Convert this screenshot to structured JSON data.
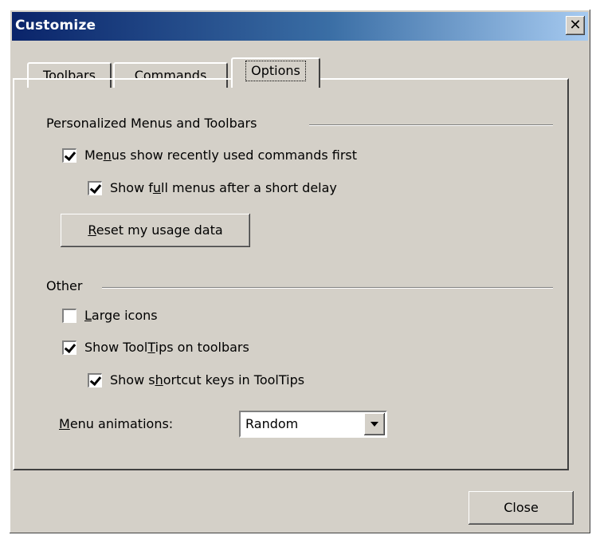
{
  "dialog": {
    "title": "Customize",
    "close_glyph": "✕"
  },
  "tabs": [
    {
      "label": "Toolbars",
      "active": false
    },
    {
      "label": "Commands",
      "active": false
    },
    {
      "label": "Options",
      "active": true
    }
  ],
  "personalized": {
    "heading": "Personalized Menus and Toolbars",
    "recent_first": {
      "pre": "Me",
      "mn": "n",
      "post": "us show recently used commands first",
      "checked": true
    },
    "full_menus": {
      "pre": "Show f",
      "mn": "u",
      "post": "ll menus after a short delay",
      "checked": true
    },
    "reset": {
      "mn": "R",
      "post": "eset my usage data"
    }
  },
  "other": {
    "heading": "Other",
    "large_icons": {
      "pre": "",
      "mn": "L",
      "post": "arge icons",
      "checked": false
    },
    "tooltips": {
      "pre": "Show Tool",
      "mn": "T",
      "post": "ips on toolbars",
      "checked": true
    },
    "shortcut_keys": {
      "pre": "Show s",
      "mn": "h",
      "post": "ortcut keys in ToolTips",
      "checked": true
    },
    "menu_animations": {
      "mn": "M",
      "post": "enu animations:",
      "value": "Random"
    }
  },
  "footer": {
    "close_label": "Close"
  }
}
